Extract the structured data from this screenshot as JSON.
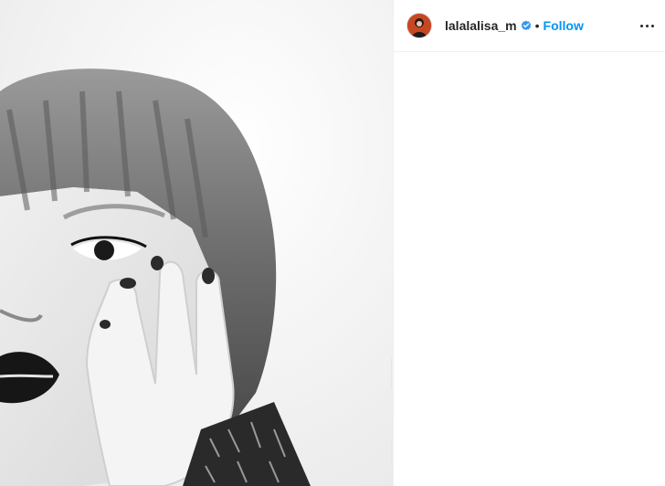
{
  "post": {
    "username": "lalalalisa_m",
    "verified": true,
    "separator": "•",
    "follow_label": "Follow",
    "more_icon": "more-options-icon",
    "image_icon": "portrait-photo"
  },
  "colors": {
    "follow": "#0095f6",
    "verified": "#3897f0",
    "text": "#262626",
    "avatar_bg": "#c74722"
  }
}
